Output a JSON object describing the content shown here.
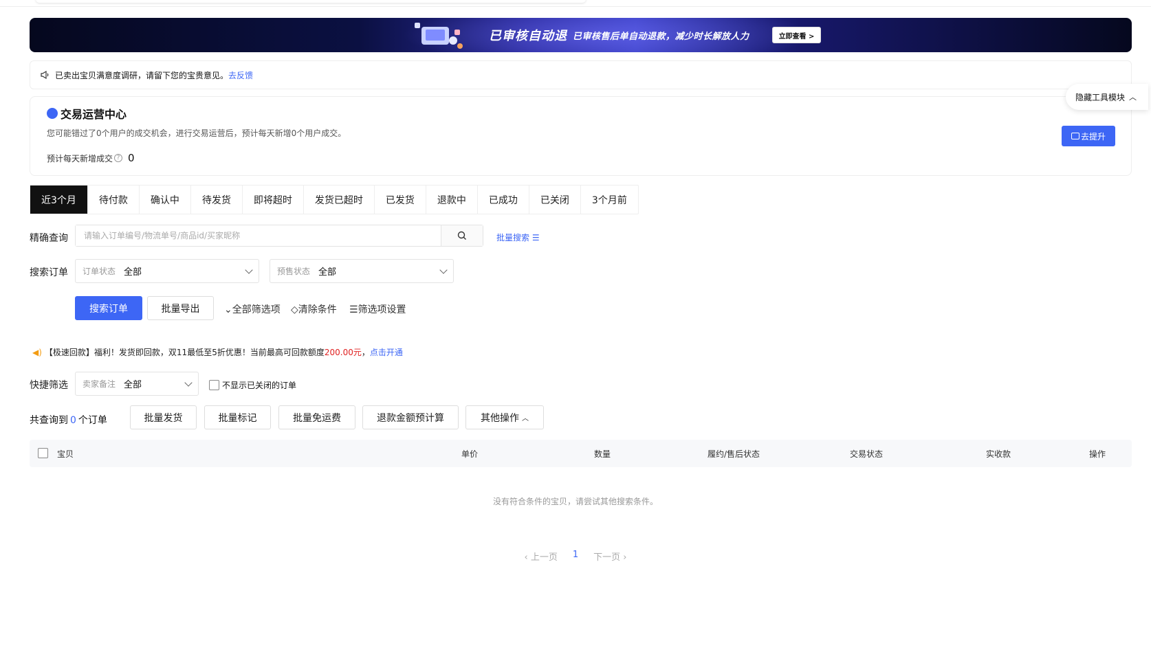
{
  "banner": {
    "title": "已审核自动退",
    "subtitle": "已审核售后单自动退款，减少时长解放人力",
    "button": "立即查看 >",
    "colors": {
      "bg": "#0b1042",
      "accent": "#3b40c7"
    }
  },
  "notice": {
    "text": "已卖出宝贝满意度调研，请留下您的宝贵意见。",
    "link": "去反馈",
    "icon": "megaphone-icon"
  },
  "ops_center": {
    "title": "交易运营中心",
    "description": "您可能错过了0个用户的成交机会，进行交易运营后，预计每天新增0个用户成交。",
    "estimate_label": "预计每天新增成交",
    "estimate_value": "0",
    "button": "去提升"
  },
  "hide_tool": {
    "label": "隐藏工具模块"
  },
  "tabs": [
    {
      "label": "近3个月",
      "active": true
    },
    {
      "label": "待付款"
    },
    {
      "label": "确认中"
    },
    {
      "label": "待发货"
    },
    {
      "label": "即将超时"
    },
    {
      "label": "发货已超时"
    },
    {
      "label": "已发货"
    },
    {
      "label": "退款中"
    },
    {
      "label": "已成功"
    },
    {
      "label": "已关闭"
    },
    {
      "label": "3个月前"
    }
  ],
  "query": {
    "label": "精确查询",
    "placeholder": "请输入订单编号/物流单号/商品id/买家昵称",
    "batch_search": "批量搜索"
  },
  "filters": {
    "label": "搜索订单",
    "order_status": {
      "key": "订单状态",
      "value": "全部"
    },
    "presale_status": {
      "key": "预售状态",
      "value": "全部"
    }
  },
  "actions": {
    "search": "搜索订单",
    "export": "批量导出",
    "all_filters": "全部筛选项",
    "clear": "清除条件",
    "filter_settings": "筛选项设置"
  },
  "promo": {
    "prefix": "【极速回款】福利！发货即回款，双11最低至5折优惠！当前最高可回款额度",
    "amount": "200.00元",
    "sep": "，",
    "link": "点击开通"
  },
  "quick_filter": {
    "label": "快捷筛选",
    "key": "卖家备注",
    "value": "全部",
    "hide_closed": "不显示已关闭的订单"
  },
  "summary": {
    "prefix": "共查询到",
    "count": "0",
    "suffix": "个订单"
  },
  "bulk_buttons": {
    "ship": "批量发货",
    "mark": "批量标记",
    "free_shipping": "批量免运费",
    "refund_calc": "退款金额预计算",
    "other": "其他操作"
  },
  "table": {
    "headers": {
      "item": "宝贝",
      "price": "单价",
      "qty": "数量",
      "fulfil": "履约/售后状态",
      "trade": "交易状态",
      "paid": "实收款",
      "ops": "操作"
    },
    "empty": "没有符合条件的宝贝，请尝试其他搜索条件。"
  },
  "pager": {
    "prev": "上一页",
    "page": "1",
    "next": "下一页"
  }
}
